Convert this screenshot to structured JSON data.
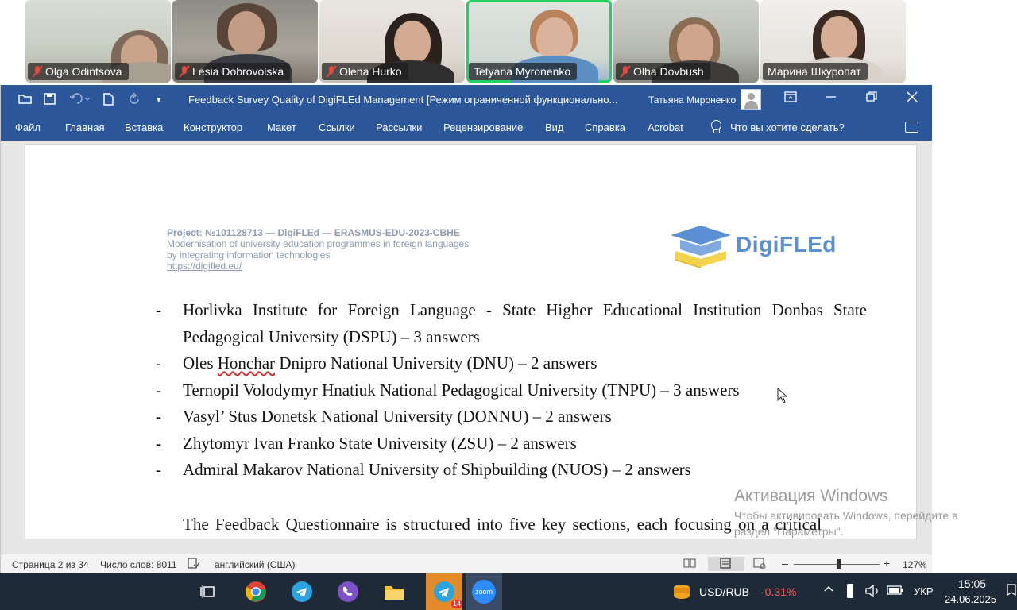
{
  "participants": [
    {
      "name": "Olga Odintsova",
      "muted": true
    },
    {
      "name": "Lesia Dobrovolska",
      "muted": true
    },
    {
      "name": "Olena Hurko",
      "muted": true
    },
    {
      "name": "Tetyana Myronenko",
      "muted": false,
      "active": true
    },
    {
      "name": "Olha Dovbush",
      "muted": true
    },
    {
      "name": "Марина Шкуропат",
      "muted": false
    }
  ],
  "word": {
    "title": "Feedback Survey Quality of DigiFLEd Management [Режим ограниченной функционально...",
    "user": "Татьяна Мироненко",
    "menu": [
      "Файл",
      "Главная",
      "Вставка",
      "Конструктор",
      "Макет",
      "Ссылки",
      "Рассылки",
      "Рецензирование",
      "Вид",
      "Справка",
      "Acrobat"
    ],
    "tell_me": "Что вы хотите сделать?"
  },
  "document": {
    "header": {
      "project": "Project: №101128713 — DigiFLEd — ERASMUS-EDU-2023-CBHE",
      "line1": "Modernisation of university education programmes in foreign languages",
      "line2": "by integrating information technologies",
      "link": "https://digifled.eu/"
    },
    "logo_text": "DigiFLEd",
    "bullet_dash": "-",
    "bullets": [
      {
        "lines": [
          "Horlivka Institute for Foreign Language - State Higher Educational Institution Donbas State",
          "Pedagogical University (DSPU) – 3 answers"
        ]
      },
      {
        "pre": "Oles ",
        "wavy": "Honchar",
        "post": " Dnipro National University (DNU) – 2 answers"
      },
      {
        "text": "Ternopil Volodymyr Hnatiuk National Pedagogical University (TNPU) – 3 answers"
      },
      {
        "text": "Vasyl’ Stus Donetsk National University (DONNU) – 2 answers"
      },
      {
        "text": "Zhytomyr Ivan Franko State University (ZSU) – 2 answers"
      },
      {
        "text": "Admiral Makarov National University of Shipbuilding (NUOS) – 2 answers"
      }
    ],
    "paragraph": "The Feedback Questionnaire is structured into five key sections, each focusing on a critical"
  },
  "status": {
    "page": "Страница 2 из 34",
    "words": "Число слов: 8011",
    "language": "английский (США)",
    "zoom_minus": "–",
    "zoom_plus": "+",
    "zoom": "127%"
  },
  "activation": {
    "line1": "Активация Windows",
    "line2": "Чтобы активировать Windows, перейдите в",
    "line3": "раздел \"Параметры\"."
  },
  "taskbar": {
    "ticker": "USD/RUB",
    "change": "-0.31%",
    "change_color": "#ff5a5a",
    "lang": "УКР",
    "time": "15:05",
    "date": "24.06.2025",
    "telegram_badge": "14",
    "zoom_app_label": "zoom"
  },
  "colors": {
    "word_blue": "#2b579a",
    "active_border": "#23d160",
    "taskbar": "#1f2a38"
  }
}
